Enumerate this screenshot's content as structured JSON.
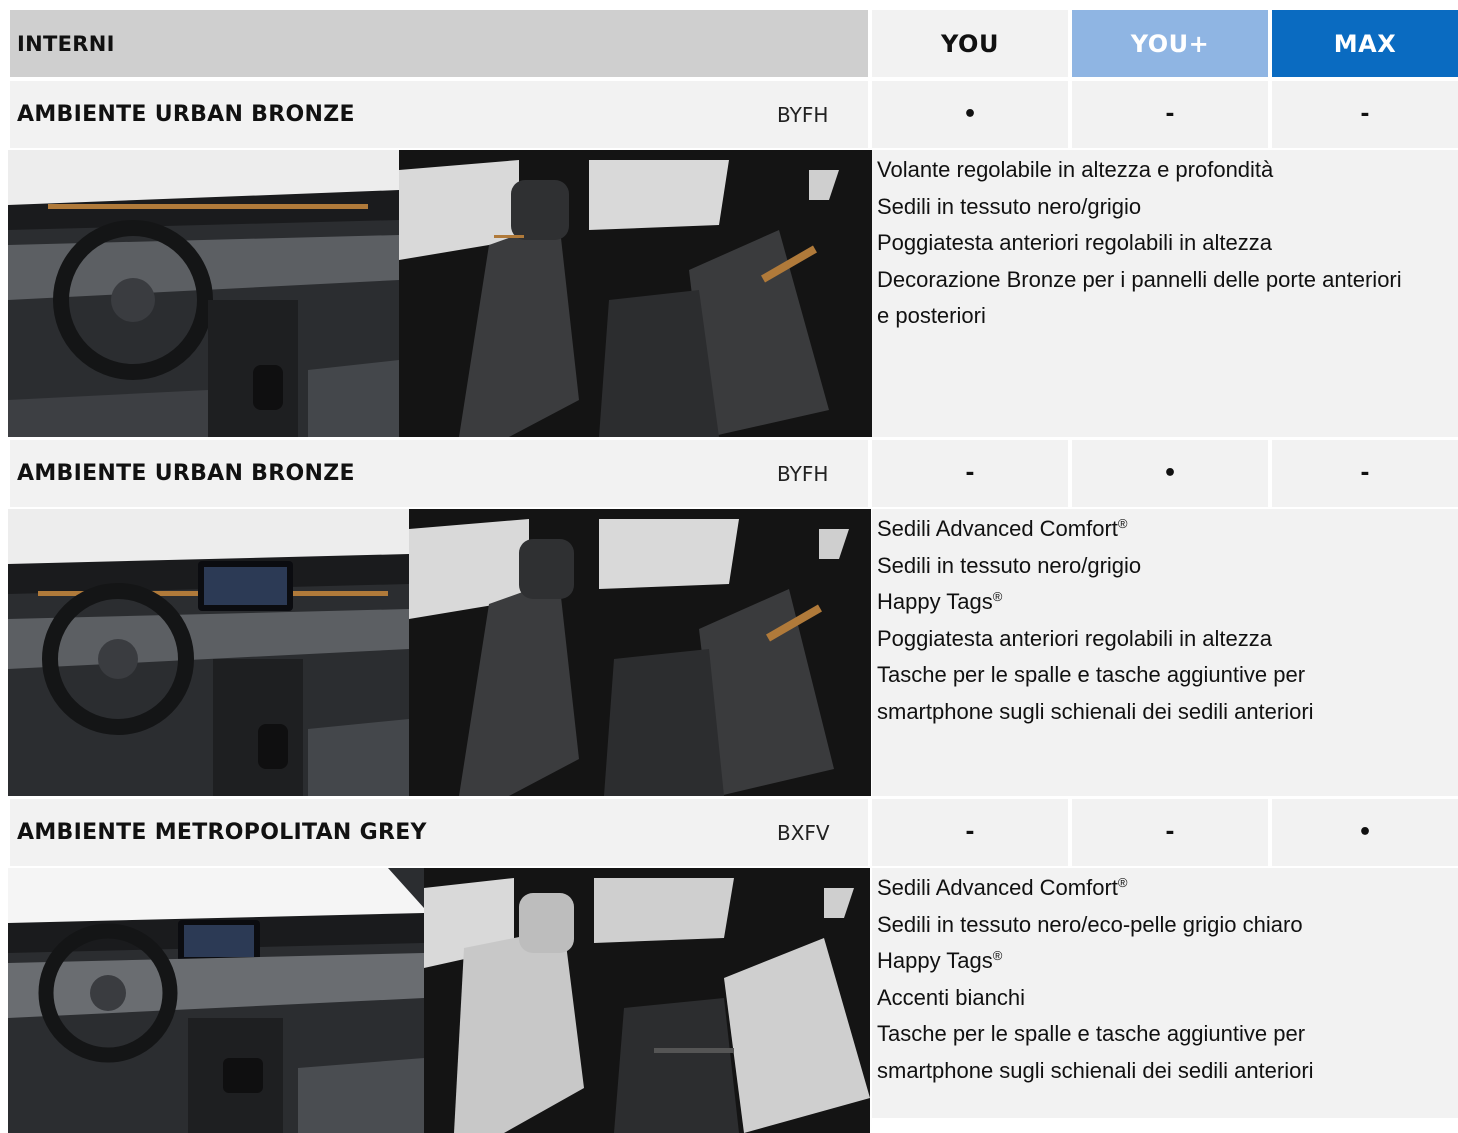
{
  "header": {
    "section_title": "INTERNI",
    "columns": [
      "YOU",
      "YOU+",
      "MAX"
    ]
  },
  "colors": {
    "you_plus": "#8fb5e3",
    "max": "#0a6bc1",
    "row_bg": "#f2f2f2",
    "header_bg": "#cfcfcf"
  },
  "sections": [
    {
      "name": "AMBIENTE URBAN BRONZE",
      "code": "BYFH",
      "marks": [
        "•",
        "-",
        "-"
      ],
      "features": [
        "Volante regolabile in altezza e profondità",
        "Sedili in tessuto nero/grigio",
        "Poggiatesta anteriori regolabili in altezza",
        "Decorazione Bronze per i pannelli delle porte anteriori",
        "e posteriori"
      ]
    },
    {
      "name": "AMBIENTE URBAN BRONZE",
      "code": "BYFH",
      "marks": [
        "-",
        "•",
        "-"
      ],
      "features": [
        "Sedili Advanced Comfort",
        "Sedili in tessuto nero/grigio",
        "Happy Tags",
        "Poggiatesta anteriori regolabili in altezza",
        "Tasche per le spalle e tasche aggiuntive per",
        "smartphone sugli schienali dei sedili anteriori"
      ]
    },
    {
      "name": "AMBIENTE METROPOLITAN GREY",
      "code": "BXFV",
      "marks": [
        "-",
        "-",
        "•"
      ],
      "features": [
        "Sedili Advanced Comfort",
        "Sedili in tessuto nero/eco-pelle grigio chiaro",
        "Happy Tags",
        "Accenti bianchi",
        "Tasche per le spalle e tasche aggiuntive per",
        "smartphone sugli schienali dei sedili anteriori"
      ]
    }
  ],
  "registered_mark": "®"
}
